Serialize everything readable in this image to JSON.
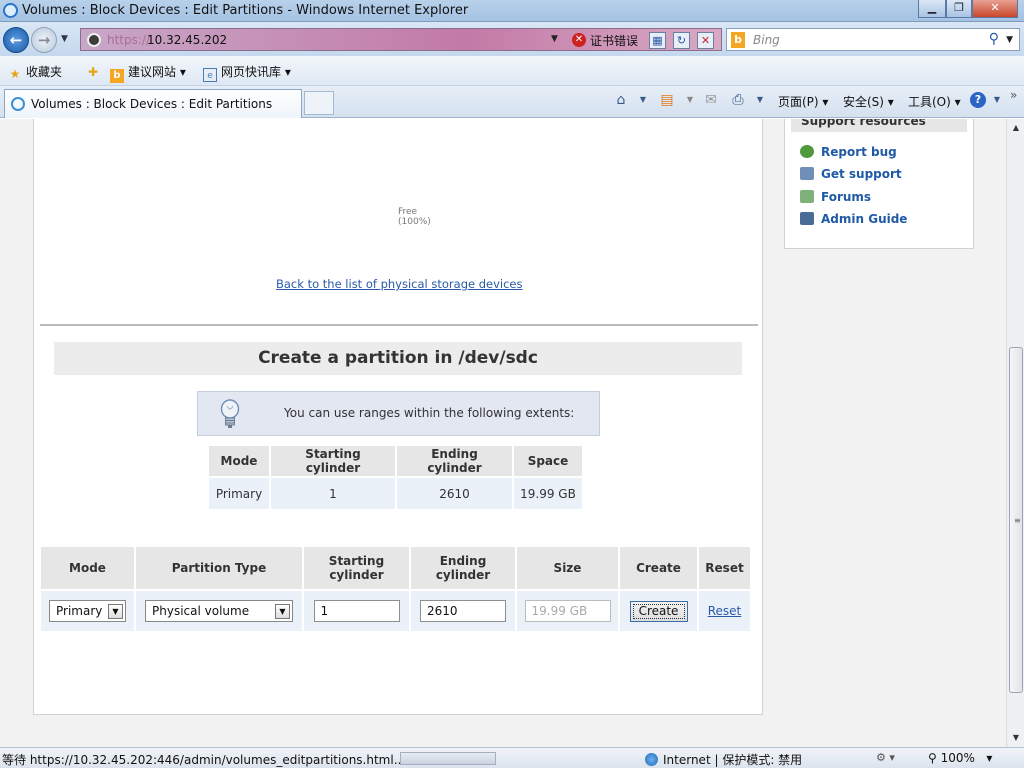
{
  "window": {
    "title": "Volumes : Block Devices : Edit Partitions - Windows Internet Explorer",
    "minimize_label": "▁",
    "maximize_label": "❐",
    "close_label": "✕"
  },
  "address_bar": {
    "protocol": "https://",
    "host": "10.32.45.202",
    "cert_error_label": "证书错误",
    "search_placeholder": "Bing"
  },
  "favorites_bar": {
    "favorites_label": "收藏夹",
    "items": [
      {
        "label": "建议网站 ▾",
        "icon": "bing-icon"
      },
      {
        "label": "网页快讯库 ▾",
        "icon": "web-slice-icon"
      }
    ]
  },
  "tabs": {
    "active_tab_label": "Volumes : Block Devices : Edit Partitions"
  },
  "command_bar": {
    "page_menu": "页面(P) ▾",
    "safety_menu": "安全(S) ▾",
    "tools_menu": "工具(O) ▾",
    "more": "»"
  },
  "page": {
    "free_label": "Free",
    "free_percent": "(100%)",
    "back_link": "Back to the list of physical storage devices",
    "create_heading": "Create a partition in /dev/sdc",
    "tip_text": "You can use ranges within the following extents:",
    "extents_table": {
      "headers": [
        "Mode",
        "Starting cylinder",
        "Ending cylinder",
        "Space"
      ],
      "rows": [
        [
          "Primary",
          "1",
          "2610",
          "19.99 GB"
        ]
      ]
    },
    "form": {
      "headers": {
        "mode": "Mode",
        "partition_type": "Partition Type",
        "starting_cylinder": "Starting cylinder",
        "ending_cylinder": "Ending cylinder",
        "size": "Size",
        "create": "Create",
        "reset": "Reset"
      },
      "mode_value": "Primary",
      "partition_type_value": "Physical volume",
      "starting_cylinder_value": "1",
      "ending_cylinder_value": "2610",
      "size_value": "19.99 GB",
      "create_button": "Create",
      "reset_link": "Reset"
    }
  },
  "sidebar": {
    "title": "Support resources",
    "links": [
      {
        "label": "Report bug",
        "icon": "bug-icon"
      },
      {
        "label": "Get support",
        "icon": "support-icon"
      },
      {
        "label": "Forums",
        "icon": "forums-icon"
      },
      {
        "label": "Admin Guide",
        "icon": "book-icon"
      }
    ]
  },
  "status_bar": {
    "status_text": "等待 https://10.32.45.202:446/admin/volumes_editpartitions.html...",
    "zone_text": "Internet | 保护模式: 禁用",
    "zoom_text": "100%"
  },
  "colors": {
    "link": "#2a5aa8",
    "sidebar_link": "#1f5aa6",
    "header_bg": "#e6e6e6",
    "cell_bg": "#eaf1f9"
  }
}
